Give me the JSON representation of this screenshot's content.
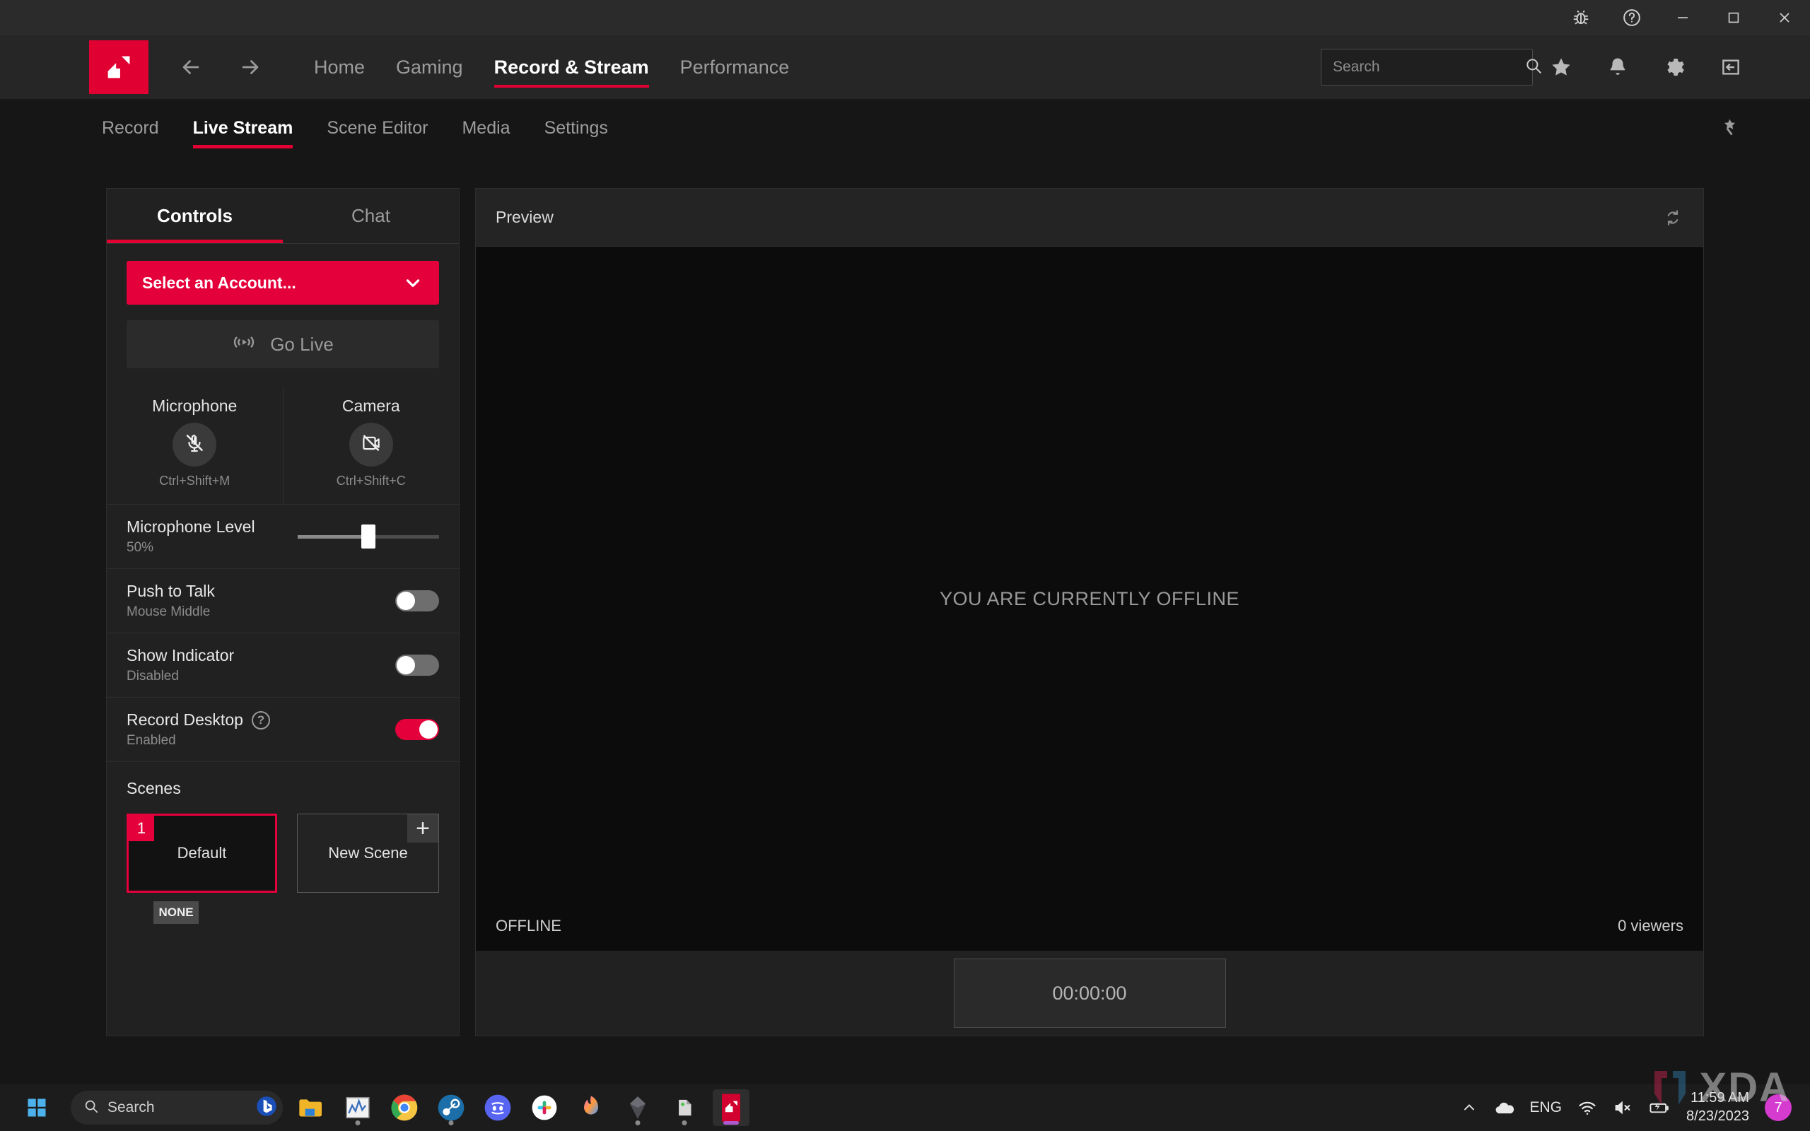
{
  "titlebar": {
    "buttons": [
      {
        "name": "bug-report-icon",
        "label": "Report a Bug"
      },
      {
        "name": "help-icon",
        "label": "Help"
      },
      {
        "name": "minimize-icon",
        "label": "Minimize"
      },
      {
        "name": "maximize-icon",
        "label": "Maximize"
      },
      {
        "name": "close-icon",
        "label": "Close"
      }
    ]
  },
  "mainnav": {
    "logo_alt": "AMD",
    "back_label": "Back",
    "forward_label": "Forward",
    "links": [
      {
        "label": "Home",
        "active": false
      },
      {
        "label": "Gaming",
        "active": false
      },
      {
        "label": "Record & Stream",
        "active": true
      },
      {
        "label": "Performance",
        "active": false
      }
    ],
    "search": {
      "value": "",
      "placeholder": "Search"
    },
    "icons": [
      {
        "name": "favorites-star-icon",
        "label": "Favorites"
      },
      {
        "name": "notifications-bell-icon",
        "label": "Notifications"
      },
      {
        "name": "settings-gear-icon",
        "label": "Settings"
      },
      {
        "name": "collapse-panel-icon",
        "label": "Collapse"
      }
    ]
  },
  "subnav": {
    "tabs": [
      {
        "label": "Record",
        "active": false
      },
      {
        "label": "Live Stream",
        "active": true
      },
      {
        "label": "Scene Editor",
        "active": false
      },
      {
        "label": "Media",
        "active": false
      },
      {
        "label": "Settings",
        "active": false
      }
    ],
    "pin_label": "Pin"
  },
  "left_panel": {
    "tabs": [
      {
        "label": "Controls",
        "active": true
      },
      {
        "label": "Chat",
        "active": false
      }
    ],
    "account_button": {
      "label": "Select an Account..."
    },
    "go_live_button": {
      "label": "Go Live"
    },
    "devices": [
      {
        "title": "Microphone",
        "hint": "Ctrl+Shift+M",
        "state": "muted"
      },
      {
        "title": "Camera",
        "hint": "Ctrl+Shift+C",
        "state": "disabled"
      }
    ],
    "settings": [
      {
        "label": "Microphone Level",
        "sub": "50%",
        "control": "slider",
        "value": 50
      },
      {
        "label": "Push to Talk",
        "sub": "Mouse Middle",
        "control": "toggle",
        "on": false
      },
      {
        "label": "Show Indicator",
        "sub": "Disabled",
        "control": "toggle",
        "on": false
      },
      {
        "label": "Record Desktop",
        "sub": "Enabled",
        "control": "toggle",
        "on": true,
        "has_help": true
      }
    ],
    "scenes": {
      "title": "Scenes",
      "current": {
        "number": "1",
        "name": "Default",
        "badge": "NONE"
      },
      "new_scene": {
        "label": "New Scene",
        "add_symbol": "+"
      }
    }
  },
  "preview": {
    "title": "Preview",
    "refresh_label": "Refresh",
    "offline_message": "YOU ARE CURRENTLY OFFLINE",
    "status": "OFFLINE",
    "viewers": "0 viewers",
    "timer": "00:00:00"
  },
  "taskbar": {
    "start_label": "Start",
    "search": {
      "label": "Search",
      "placeholder": "Search"
    },
    "apps": [
      {
        "name": "file-explorer-icon",
        "label": "File Explorer",
        "running": false
      },
      {
        "name": "chart-app-icon",
        "label": "Performance Monitor",
        "running": true
      },
      {
        "name": "chrome-icon",
        "label": "Google Chrome",
        "running": false
      },
      {
        "name": "steam-icon",
        "label": "Steam",
        "running": true
      },
      {
        "name": "discord-icon",
        "label": "Discord",
        "running": false
      },
      {
        "name": "slack-icon",
        "label": "Slack",
        "running": false
      },
      {
        "name": "firefox-icon",
        "label": "Firefox",
        "running": false
      },
      {
        "name": "gem-app-icon",
        "label": "Gem App",
        "running": true
      },
      {
        "name": "object-app-icon",
        "label": "3D Viewer",
        "running": true
      },
      {
        "name": "amd-software-icon",
        "label": "AMD Software",
        "running": true,
        "active": true
      }
    ],
    "tray": {
      "chevron_label": "Show hidden icons",
      "cloud_label": "OneDrive",
      "language": "ENG",
      "wifi_label": "Network",
      "volume_label": "Volume muted",
      "battery_label": "Battery charging",
      "time": "11:59 AM",
      "date": "8/23/2023",
      "badge": "7"
    }
  },
  "watermark": {
    "text": "XDA"
  },
  "colors": {
    "accent": "#e00132",
    "accent_button": "#e4003a",
    "window_bg": "#161616",
    "panel_bg": "#212121",
    "titlebar_bg": "#2b2b2b"
  }
}
